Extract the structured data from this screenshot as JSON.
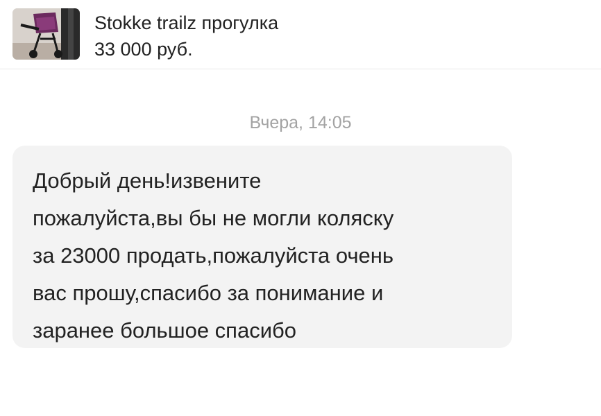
{
  "listing": {
    "title": "Stokke trailz прогулка",
    "price": "33 000 руб.",
    "thumbnail_icon": "stroller-photo"
  },
  "conversation": {
    "timestamp": "Вчера, 14:05",
    "messages": [
      {
        "text": "Добрый день!извените\nпожалуйста,вы бы не могли коляску\nза 23000 продать,пожалуйста очень\nвас прошу,спасибо за понимание и\nзаранее большое спасибо"
      }
    ]
  },
  "colors": {
    "bubble_background": "#f3f3f3",
    "timestamp_text": "#a3a3a3",
    "primary_text": "#222222",
    "divider": "#e6e6e6"
  }
}
